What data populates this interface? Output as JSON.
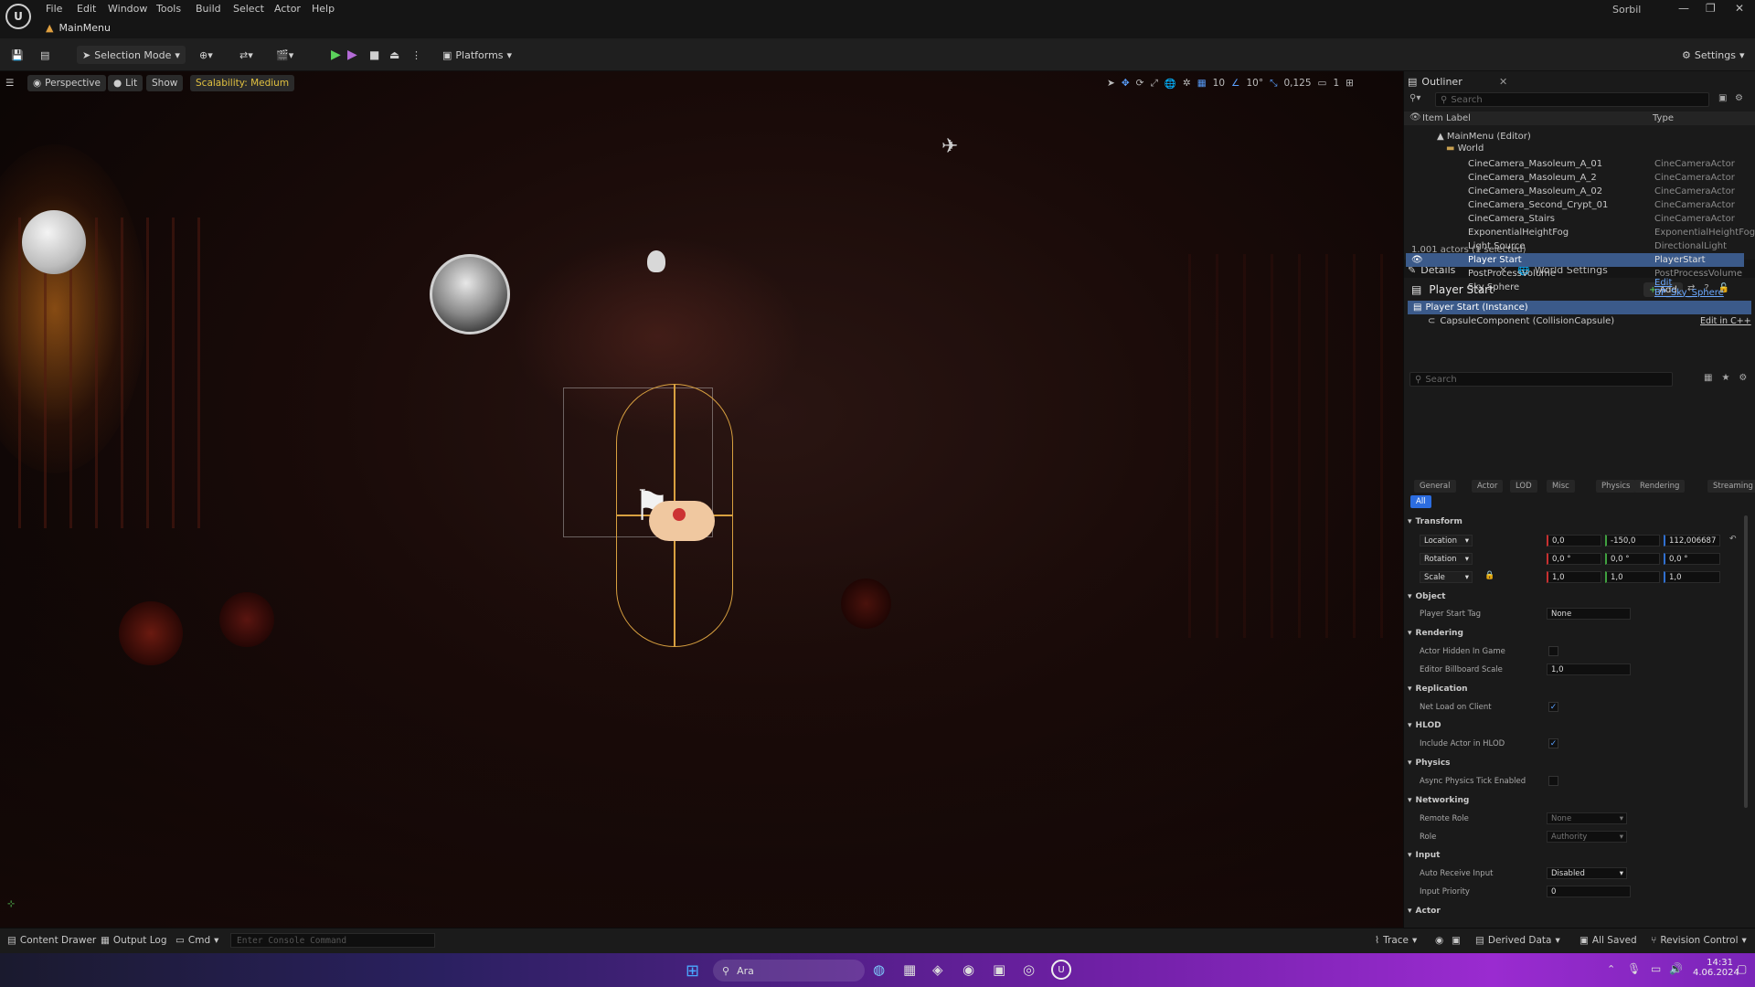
{
  "menu": [
    "File",
    "Edit",
    "Window",
    "Tools",
    "Build",
    "Select",
    "Actor",
    "Help"
  ],
  "doc_tab": "MainMenu",
  "user": "Sorbil",
  "toolbar": {
    "selection_mode": "Selection Mode",
    "platforms": "Platforms",
    "settings": "Settings"
  },
  "viewport_toolbar": {
    "perspective": "Perspective",
    "lit": "Lit",
    "show": "Show",
    "scalability": "Scalability: Medium",
    "grid": "10",
    "angle": "10°",
    "scale": "0,125",
    "cam": "1"
  },
  "outliner": {
    "title": "Outliner",
    "search_placeholder": "Search",
    "col_label": "Item Label",
    "col_type": "Type",
    "root": "MainMenu (Editor)",
    "world": "World",
    "rows": [
      {
        "label": "CineCamera_Masoleum_A_01",
        "type": "CineCameraActor"
      },
      {
        "label": "CineCamera_Masoleum_A_2",
        "type": "CineCameraActor"
      },
      {
        "label": "CineCamera_Masoleum_A_02",
        "type": "CineCameraActor"
      },
      {
        "label": "CineCamera_Second_Crypt_01",
        "type": "CineCameraActor"
      },
      {
        "label": "CineCamera_Stairs",
        "type": "CineCameraActor"
      },
      {
        "label": "ExponentialHeightFog",
        "type": "ExponentialHeightFog"
      },
      {
        "label": "Light Source",
        "type": "DirectionalLight"
      },
      {
        "label": "Player Start",
        "type": "PlayerStart"
      },
      {
        "label": "PostProcessVolume",
        "type": "PostProcessVolume"
      },
      {
        "label": "Sky Sphere",
        "type": "Edit BP_Sky_Sphere"
      }
    ],
    "count": "1.001 actors (1 selected)"
  },
  "details": {
    "tab": "Details",
    "tab2": "World Settings",
    "actor": "Player Start",
    "add": "Add",
    "instance": "Player Start (Instance)",
    "component": "CapsuleComponent (CollisionCapsule)",
    "edit_cpp": "Edit in C++",
    "search_placeholder": "Search",
    "filters": [
      "General",
      "Actor",
      "LOD",
      "Misc",
      "Physics",
      "Rendering",
      "Streaming"
    ],
    "all": "All",
    "transform": "Transform",
    "location": "Location",
    "loc": [
      "0,0",
      "-150,0",
      "112,006687"
    ],
    "rotation": "Rotation",
    "rot": [
      "0,0 °",
      "0,0 °",
      "0,0 °"
    ],
    "scale": "Scale",
    "scl": [
      "1,0",
      "1,0",
      "1,0"
    ],
    "cat_object": "Object",
    "player_start_tag": "Player Start Tag",
    "tag_val": "None",
    "cat_rendering": "Rendering",
    "hidden": "Actor Hidden In Game",
    "billboard": "Editor Billboard Scale",
    "billboard_val": "1,0",
    "cat_replication": "Replication",
    "net_load": "Net Load on Client",
    "cat_hlod": "HLOD",
    "include_hlod": "Include Actor in HLOD",
    "cat_physics": "Physics",
    "async": "Async Physics Tick Enabled",
    "cat_networking": "Networking",
    "remote_role": "Remote Role",
    "remote_val": "None",
    "role": "Role",
    "role_val": "Authority",
    "cat_input": "Input",
    "auto_input": "Auto Receive Input",
    "auto_val": "Disabled",
    "input_priority": "Input Priority",
    "priority_val": "0",
    "cat_actor": "Actor"
  },
  "status": {
    "content_drawer": "Content Drawer",
    "output_log": "Output Log",
    "cmd": "Cmd",
    "console_placeholder": "Enter Console Command",
    "trace": "Trace",
    "derived": "Derived Data",
    "saved": "All Saved",
    "revision": "Revision Control"
  },
  "taskbar": {
    "search": "Ara",
    "time": "14:31",
    "date": "4.06.2024"
  }
}
